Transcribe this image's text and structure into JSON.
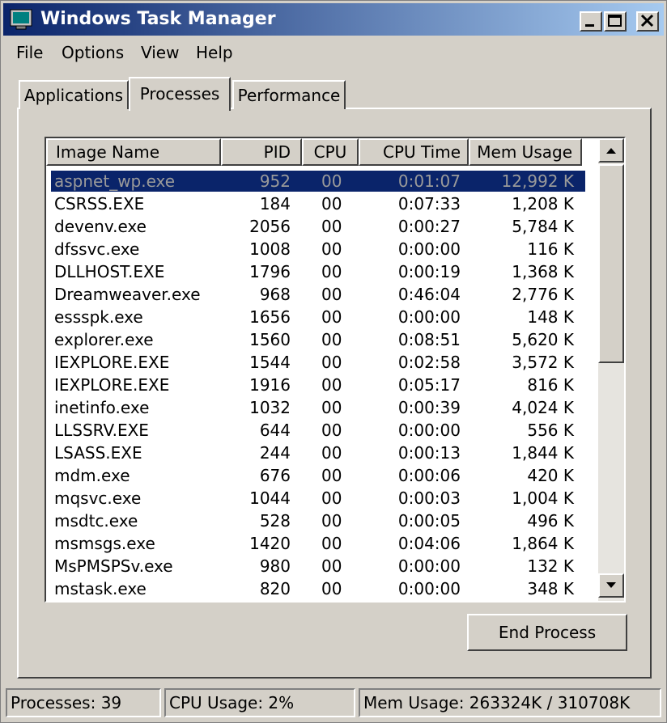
{
  "window": {
    "title": "Windows Task Manager"
  },
  "titlebar_buttons": [
    "minimize",
    "maximize",
    "close"
  ],
  "menu": [
    "File",
    "Options",
    "View",
    "Help"
  ],
  "tabs": [
    "Applications",
    "Processes",
    "Performance"
  ],
  "active_tab": "Processes",
  "columns": [
    "Image Name",
    "PID",
    "CPU",
    "CPU Time",
    "Mem Usage"
  ],
  "rows": [
    {
      "name": "aspnet_wp.exe",
      "pid": "952",
      "cpu": "00",
      "time": "0:01:07",
      "mem": "12,992 K",
      "selected": true
    },
    {
      "name": "CSRSS.EXE",
      "pid": "184",
      "cpu": "00",
      "time": "0:07:33",
      "mem": "1,208 K"
    },
    {
      "name": "devenv.exe",
      "pid": "2056",
      "cpu": "00",
      "time": "0:00:27",
      "mem": "5,784 K"
    },
    {
      "name": "dfssvc.exe",
      "pid": "1008",
      "cpu": "00",
      "time": "0:00:00",
      "mem": "116 K"
    },
    {
      "name": "DLLHOST.EXE",
      "pid": "1796",
      "cpu": "00",
      "time": "0:00:19",
      "mem": "1,368 K"
    },
    {
      "name": "Dreamweaver.exe",
      "pid": "968",
      "cpu": "00",
      "time": "0:46:04",
      "mem": "2,776 K"
    },
    {
      "name": "essspk.exe",
      "pid": "1656",
      "cpu": "00",
      "time": "0:00:00",
      "mem": "148 K"
    },
    {
      "name": "explorer.exe",
      "pid": "1560",
      "cpu": "00",
      "time": "0:08:51",
      "mem": "5,620 K"
    },
    {
      "name": "IEXPLORE.EXE",
      "pid": "1544",
      "cpu": "00",
      "time": "0:02:58",
      "mem": "3,572 K"
    },
    {
      "name": "IEXPLORE.EXE",
      "pid": "1916",
      "cpu": "00",
      "time": "0:05:17",
      "mem": "816 K"
    },
    {
      "name": "inetinfo.exe",
      "pid": "1032",
      "cpu": "00",
      "time": "0:00:39",
      "mem": "4,024 K"
    },
    {
      "name": "LLSSRV.EXE",
      "pid": "644",
      "cpu": "00",
      "time": "0:00:00",
      "mem": "556 K"
    },
    {
      "name": "LSASS.EXE",
      "pid": "244",
      "cpu": "00",
      "time": "0:00:13",
      "mem": "1,844 K"
    },
    {
      "name": "mdm.exe",
      "pid": "676",
      "cpu": "00",
      "time": "0:00:06",
      "mem": "420 K"
    },
    {
      "name": "mqsvc.exe",
      "pid": "1044",
      "cpu": "00",
      "time": "0:00:03",
      "mem": "1,004 K"
    },
    {
      "name": "msdtc.exe",
      "pid": "528",
      "cpu": "00",
      "time": "0:00:05",
      "mem": "496 K"
    },
    {
      "name": "msmsgs.exe",
      "pid": "1420",
      "cpu": "00",
      "time": "0:04:06",
      "mem": "1,864 K"
    },
    {
      "name": "MsPMSPSv.exe",
      "pid": "980",
      "cpu": "00",
      "time": "0:00:00",
      "mem": "132 K"
    },
    {
      "name": "mstask.exe",
      "pid": "820",
      "cpu": "00",
      "time": "0:00:00",
      "mem": "348 K"
    }
  ],
  "end_process_label": "End Process",
  "status": {
    "processes": "Processes: 39",
    "cpu": "CPU Usage: 2%",
    "mem": "Mem Usage: 263324K / 310708K"
  }
}
